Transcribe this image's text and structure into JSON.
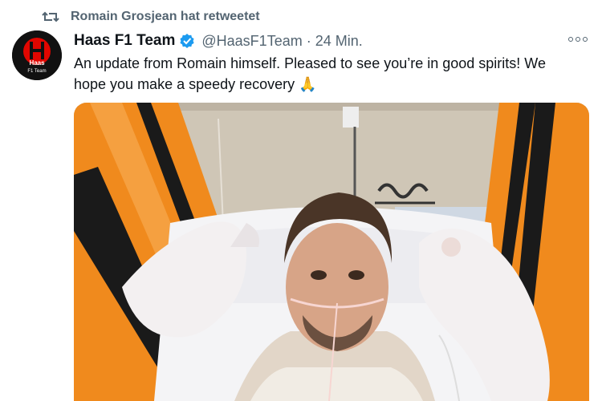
{
  "retweet": {
    "icon": "retweet-icon",
    "text": "Romain Grosjean hat retweetet"
  },
  "author": {
    "name": "Haas F1 Team",
    "handle": "@HaasF1Team",
    "separator": "·",
    "time": "24 Min.",
    "verified": true,
    "avatar_logo_text": "Haas",
    "avatar_sub_text": "F1 Team"
  },
  "tweet": {
    "text_line1": "An update from Romain himself. Pleased to see you’re in good spirits! We",
    "text_line2": "hope you make a speedy recovery",
    "emoji": "🙏"
  },
  "colors": {
    "retweet_gray": "#536471",
    "text": "#0f1419",
    "verified_blue": "#1d9bf0",
    "haas_red": "#e10600"
  }
}
